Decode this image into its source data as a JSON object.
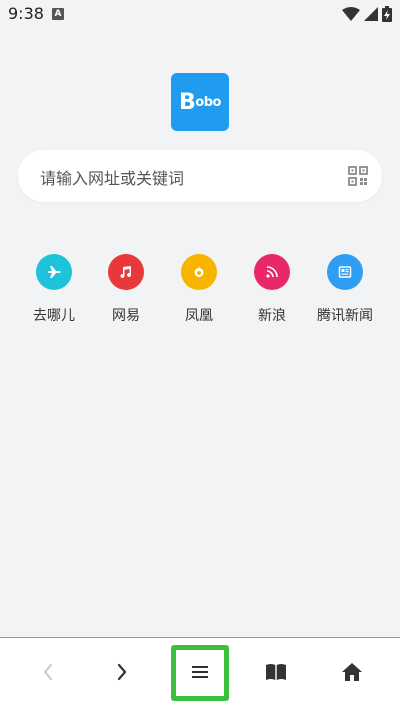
{
  "status_bar": {
    "time": "9:38",
    "notification_icon": "a-badge-icon",
    "wifi_icon": "wifi-icon",
    "signal_icon": "signal-icon",
    "battery_icon": "battery-charging-icon"
  },
  "logo": {
    "text_first": "B",
    "text_rest": "obo"
  },
  "search": {
    "placeholder": "请输入网址或关键词",
    "scan_icon": "qr-scan-icon"
  },
  "shortcuts": [
    {
      "label": "去哪儿",
      "icon": "airplane-icon",
      "color": "#1ec2d9"
    },
    {
      "label": "网易",
      "icon": "music-note-icon",
      "color": "#e8383b"
    },
    {
      "label": "凤凰",
      "icon": "phoenix-icon",
      "color": "#f7b500"
    },
    {
      "label": "新浪",
      "icon": "rss-icon",
      "color": "#e8286a"
    },
    {
      "label": "腾讯新闻",
      "icon": "news-icon",
      "color": "#2f9ef2"
    }
  ],
  "bottom_nav": {
    "back_icon": "chevron-left-icon",
    "forward_icon": "chevron-right-icon",
    "menu_icon": "menu-icon",
    "bookmarks_icon": "book-icon",
    "home_icon": "home-icon",
    "highlight_color": "#3cc03c"
  }
}
